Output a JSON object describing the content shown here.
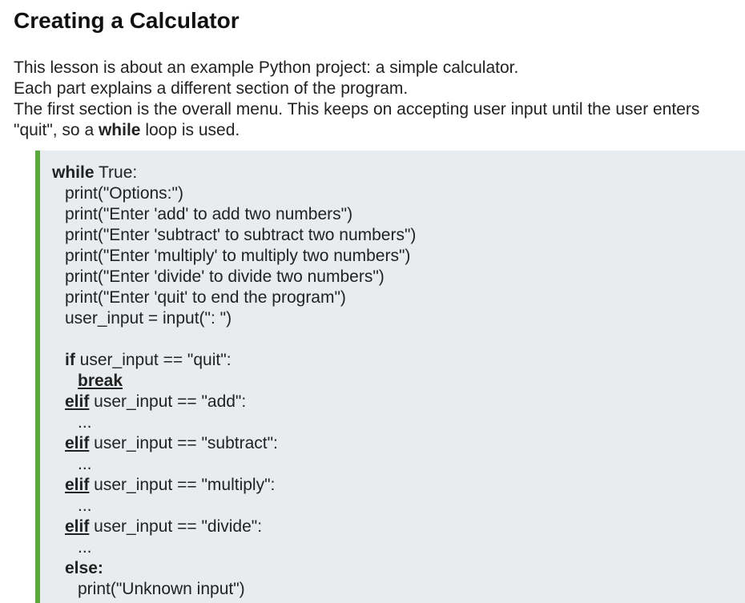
{
  "page": {
    "title": "Creating a Calculator"
  },
  "intro": {
    "line1": "This lesson is about an example Python project: a simple calculator.",
    "line2": "Each part explains a different section of the program.",
    "line3": "The first section is the overall menu. This keeps on accepting user input until the user enters",
    "line4_before": "\"quit\", so a ",
    "line4_keyword": "while",
    "line4_after": " loop is used."
  },
  "code": {
    "accent_color": "#5ba83c",
    "background_color": "#e9ecee",
    "l01_kw": "while",
    "l01_rest": " True:",
    "l02": "print(\"Options:\")",
    "l03": "print(\"Enter 'add' to add two numbers\")",
    "l04": "print(\"Enter 'subtract' to subtract two numbers\")",
    "l05": "print(\"Enter 'multiply' to multiply two numbers\")",
    "l06": "print(\"Enter 'divide' to divide two numbers\")",
    "l07": "print(\"Enter 'quit' to end the program\")",
    "l08": "user_input = input(\": \")",
    "l10_kw": "if",
    "l10_rest": " user_input == \"quit\":",
    "l11_kw": "break",
    "l12_kw": "elif",
    "l12_rest": " user_input == \"add\":",
    "l13": "...",
    "l14_kw": "elif",
    "l14_rest": " user_input == \"subtract\":",
    "l15": "...",
    "l16_kw": "elif",
    "l16_rest": " user_input == \"multiply\":",
    "l17": "...",
    "l18_kw": "elif",
    "l18_rest": " user_input == \"divide\":",
    "l19": "...",
    "l20_kw": "else:",
    "l21": "print(\"Unknown input\")"
  }
}
